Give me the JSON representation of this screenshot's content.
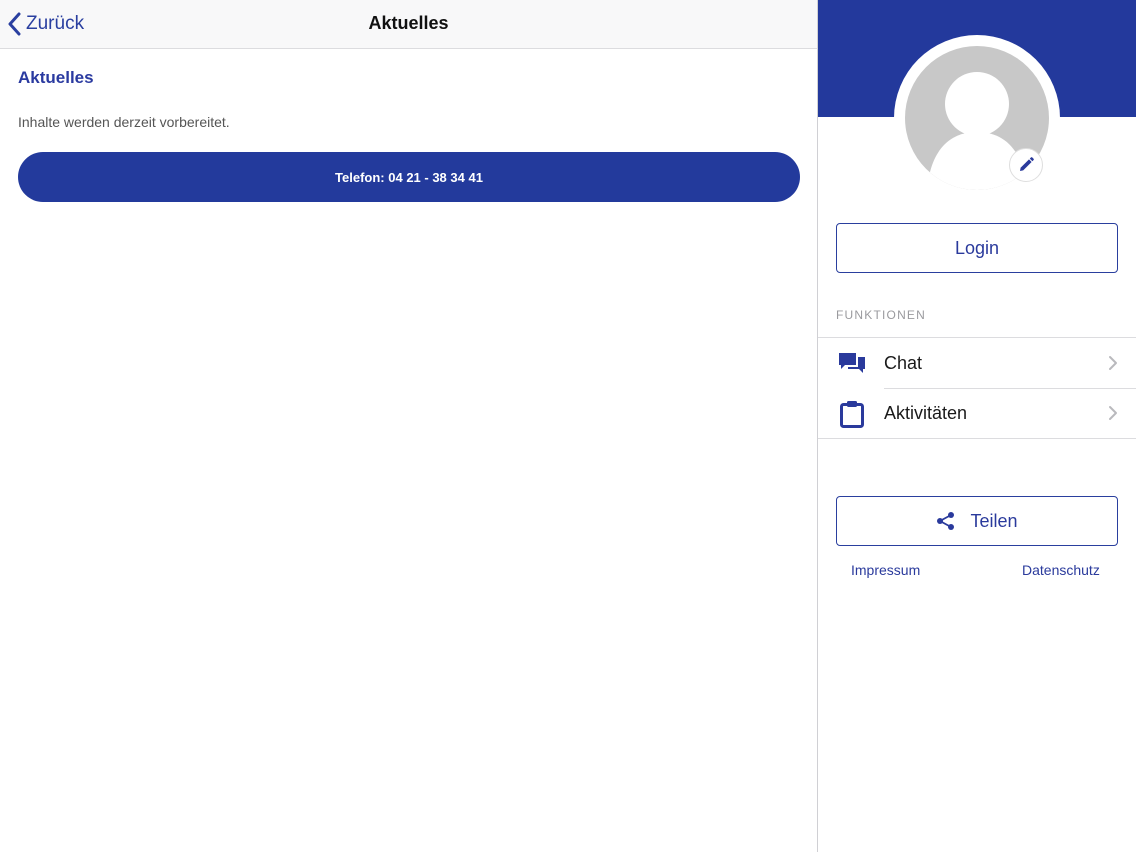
{
  "navbar": {
    "back_label": "Zurück",
    "title": "Aktuelles"
  },
  "content": {
    "heading": "Aktuelles",
    "text": "Inhalte werden derzeit vorbereitet.",
    "phone_button_label": "Telefon: 04 21 - 38 34 41"
  },
  "sidebar": {
    "login_label": "Login",
    "section_label": "FUNKTIONEN",
    "items": [
      {
        "label": "Chat",
        "icon": "chat-icon"
      },
      {
        "label": "Aktivitäten",
        "icon": "clipboard-icon"
      }
    ],
    "share_label": "Teilen",
    "footer": {
      "impressum": "Impressum",
      "datenschutz": "Datenschutz"
    }
  },
  "colors": {
    "brand": "#23399c",
    "link": "#2a3a9c",
    "avatar_placeholder": "#c8c8c8"
  }
}
